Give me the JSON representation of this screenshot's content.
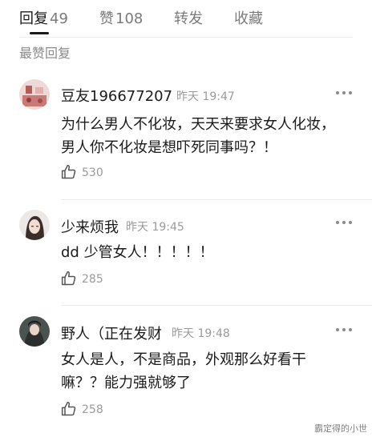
{
  "tabs": [
    {
      "label": "回复",
      "count": "49"
    },
    {
      "label": "赞",
      "count": "108"
    },
    {
      "label": "转发",
      "count": ""
    },
    {
      "label": "收藏",
      "count": ""
    }
  ],
  "section_title": "最赞回复",
  "comments": [
    {
      "username": "豆友196677207",
      "time": "昨天 19:47",
      "text": "为什么男人不化妆，天天来要求女人化妆，男人你不化妆是想吓死同事吗？！",
      "likes": "530"
    },
    {
      "username": "少来烦我",
      "time": "昨天 19:45",
      "text": "dd 少管女人！！！！！",
      "likes": "285"
    },
    {
      "username": "野人（正在发财",
      "time": "昨天 19:48",
      "text": "女人是人，不是商品，外观那么好看干嘛？？能力强就够了",
      "likes": "258"
    }
  ],
  "watermark": "霸定得的小世",
  "icons": {
    "more": "more-dots-icon",
    "like": "thumbs-up-icon"
  },
  "colors": {
    "text_primary": "#1a1a1a",
    "text_secondary": "#9a9a9a",
    "divider": "#ececec",
    "background": "#ffffff"
  }
}
